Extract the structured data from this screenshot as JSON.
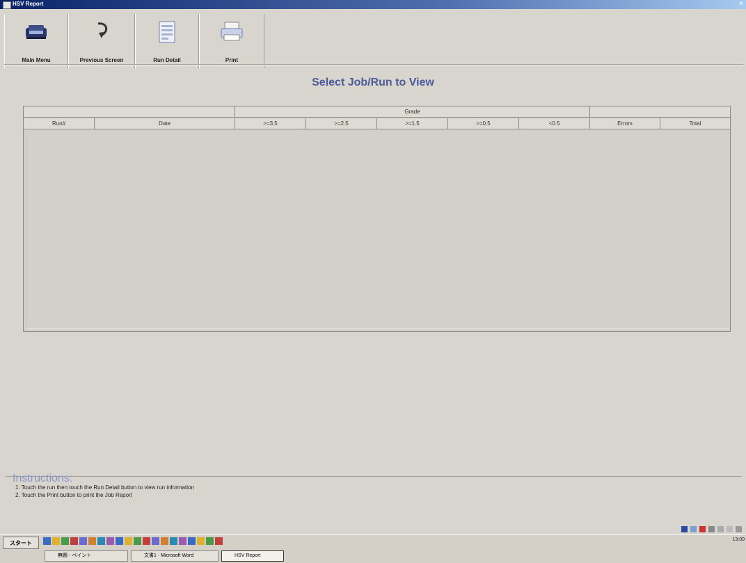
{
  "window": {
    "title": "HSV Report"
  },
  "toolbar": {
    "main_menu": "Main Menu",
    "previous_screen": "Previous Screen",
    "run_detail": "Run Detail",
    "print": "Print"
  },
  "page_title": "Select Job/Run to View",
  "table": {
    "group_header": "Grade",
    "columns": [
      "Run#",
      "Date",
      ">=3.5",
      ">=2.5",
      ">=1.5",
      ">=0.5",
      "<0.5",
      "Errors",
      "Total"
    ],
    "rows": []
  },
  "instructions": {
    "title": "Instructions:",
    "lines": [
      "1. Touch the run then touch the Run Detail button to view run information",
      "2. Touch the Print button to print the Job Report"
    ]
  },
  "taskbar": {
    "start": "スタート",
    "tasks": [
      "無題 - ペイント",
      "文書1 - Microsoft Word",
      "HSV Report"
    ],
    "clock": "13:00"
  },
  "colors": {
    "title_accent": "#4a5a9a",
    "instructions_accent": "#8a96c8",
    "titlebar": "#0a246a"
  }
}
